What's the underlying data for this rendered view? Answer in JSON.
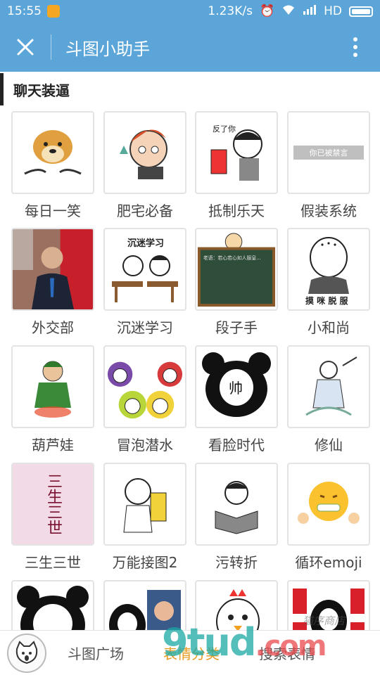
{
  "status_bar": {
    "time": "15:55",
    "network_speed": "1.23K/s",
    "network_type": "HD"
  },
  "app_bar": {
    "title": "斗图小助手",
    "close_icon": "close-icon",
    "more_icon": "more-vertical-icon"
  },
  "section": {
    "title": "聊天装逼"
  },
  "items": [
    {
      "label": "每日一笑"
    },
    {
      "label": "肥宅必备"
    },
    {
      "label": "抵制乐天",
      "thumb_text": "反了你"
    },
    {
      "label": "假装系统",
      "thumb_text": "你已被禁言"
    },
    {
      "label": "外交部"
    },
    {
      "label": "沉迷学习",
      "thumb_text": "沉迷学习"
    },
    {
      "label": "段子手",
      "thumb_text": "老语：若心若心如人服皇..."
    },
    {
      "label": "小和尚",
      "thumb_text": "摸 咪 脱 服"
    },
    {
      "label": "葫芦娃"
    },
    {
      "label": "冒泡潜水"
    },
    {
      "label": "看脸时代",
      "thumb_text": "帅"
    },
    {
      "label": "修仙"
    },
    {
      "label": "三生三世",
      "thumb_text": "三生三世"
    },
    {
      "label": "万能接图2"
    },
    {
      "label": "污转折"
    },
    {
      "label": "循环emoji"
    },
    {
      "label": ""
    },
    {
      "label": ""
    },
    {
      "label": ""
    },
    {
      "label": ""
    }
  ],
  "bottom_bar": {
    "tabs": [
      {
        "label": "斗图广场",
        "active": false
      },
      {
        "label": "表情分类",
        "active": true
      },
      {
        "label": "搜索表情",
        "active": false
      }
    ]
  },
  "watermark": {
    "main": "9tud",
    "suffix": ".com",
    "signature": "猫序商店"
  },
  "colors": {
    "primary": "#5ba5d8",
    "active_tab": "#e89a1e"
  }
}
